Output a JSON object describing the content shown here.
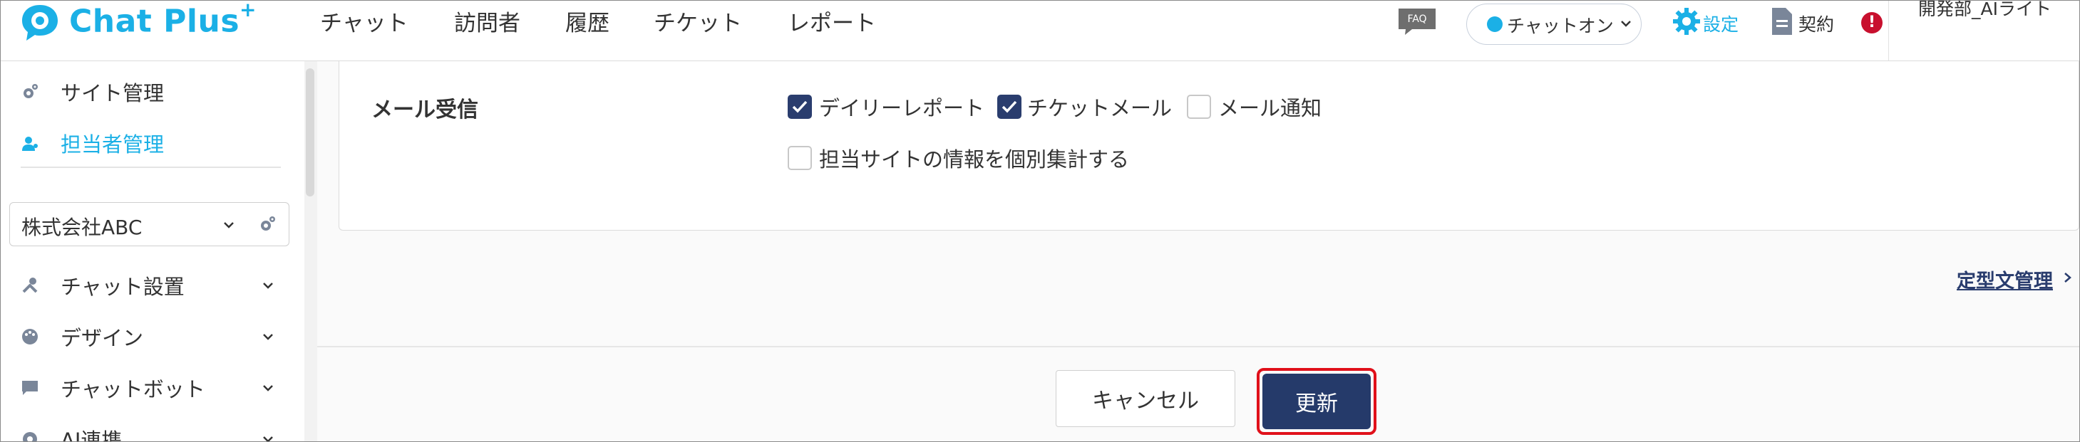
{
  "header": {
    "logo_text": "Chat Plus",
    "logo_sup": "+",
    "nav": [
      "チャット",
      "訪問者",
      "履歴",
      "チケット",
      "レポート"
    ],
    "faq_label": "FAQ",
    "status_label": "チャットオン",
    "settings_label": "設定",
    "contract_label": "契約",
    "user_label": "開発部_AIライト"
  },
  "sidebar": {
    "top_items": [
      {
        "label": "サイト管理",
        "icon": "gear-icon"
      },
      {
        "label": "担当者管理",
        "icon": "person-icon",
        "active": true
      }
    ],
    "company_select": "株式会社ABC",
    "menu": [
      {
        "label": "チャット設置",
        "icon": "tools-icon"
      },
      {
        "label": "デザイン",
        "icon": "palette-icon"
      },
      {
        "label": "チャットボット",
        "icon": "chat-icon"
      },
      {
        "label": "AI連携",
        "icon": "ai-icon"
      }
    ]
  },
  "mail": {
    "title": "メール受信",
    "options": [
      {
        "label": "デイリーレポート",
        "checked": true
      },
      {
        "label": "チケットメール",
        "checked": true
      },
      {
        "label": "メール通知",
        "checked": false
      },
      {
        "label": "担当サイトの情報を個別集計する",
        "checked": false
      }
    ]
  },
  "links": {
    "template_mgmt": "定型文管理"
  },
  "buttons": {
    "cancel": "キャンセル",
    "update": "更新"
  },
  "colors": {
    "brand": "#1bb0e6",
    "navy": "#253a6a",
    "highlight": "#e0101a"
  }
}
